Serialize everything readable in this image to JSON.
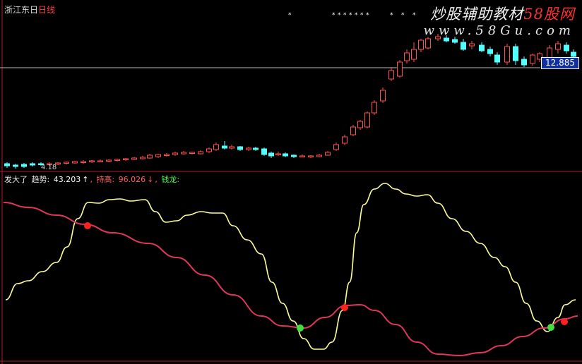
{
  "header": {
    "stock_name": "浙江东日",
    "period": "日线"
  },
  "watermark": {
    "text_prefix": "炒股辅助教材",
    "brand": "58股网",
    "url": "www.58Gu.com"
  },
  "price_tag": "12.885",
  "low_label": "4.18",
  "indicator": {
    "name": "发大了",
    "trend_label": "趋势:",
    "trend_value": "43.203",
    "trend_arrow": "↑",
    "hold_label": "持高:",
    "hold_value": "96.026",
    "hold_arrow": "↓",
    "qianlong_label": "钱龙:"
  },
  "colors": {
    "background": "#000000",
    "up_candle": "#ff5050",
    "down_candle": "#54ffff",
    "trend_line": "#ffff99",
    "hold_line": "#e0365a",
    "buy_dot": "#40e040",
    "sell_dot": "#ff2020",
    "divider": "#b02020",
    "price_line": "#bdbdbd",
    "trend_text": "#ffffff",
    "hold_text": "#ff6060",
    "qianlong_text": "#40ff40"
  }
}
